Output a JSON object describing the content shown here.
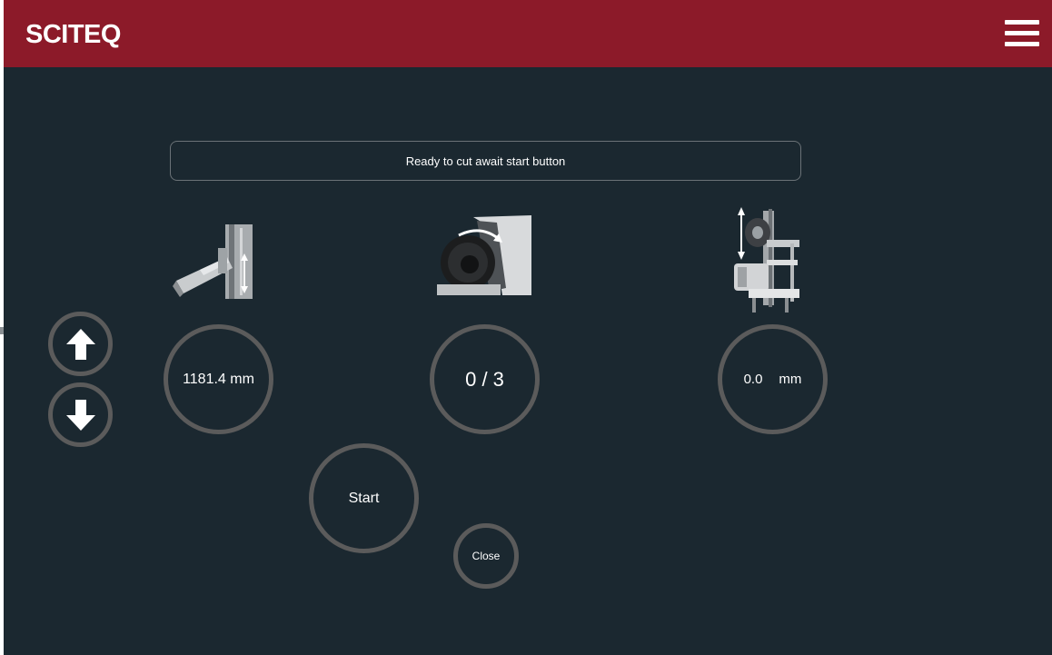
{
  "header": {
    "logo": "SCITEQ",
    "menu_icon": "hamburger-menu-icon"
  },
  "status": {
    "message": "Ready to cut await start button"
  },
  "colors": {
    "header_bg": "#8c1a29",
    "body_bg": "#1b2830",
    "ring": "#5b5b5b",
    "text": "#ffffff"
  },
  "controls": {
    "up_icon": "arrow-up-icon",
    "down_icon": "arrow-down-icon",
    "height_value": "1181.4 mm",
    "cut_count": "0 / 3",
    "depth_value": "0.0",
    "depth_unit": "mm",
    "start_label": "Start",
    "close_label": "Close"
  },
  "icons": {
    "height_axis": "saw-height-axis-icon",
    "blade_rotation": "blade-rotation-icon",
    "depth_axis": "depth-axis-icon"
  }
}
